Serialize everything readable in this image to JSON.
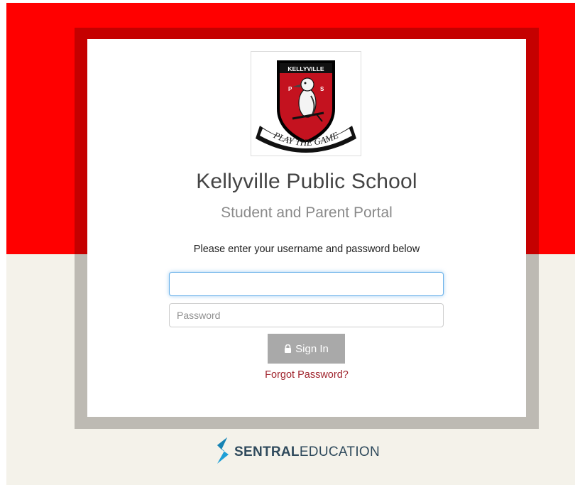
{
  "colors": {
    "brand_red": "#ff0000",
    "frame_dark_red": "#c50000",
    "cream": "#f4f2ea",
    "frame_grey": "#bdbab3",
    "button_grey": "#a9a9a9",
    "link_red": "#a0252e",
    "sentral_blue": "#1e9fd6"
  },
  "logo": {
    "top_text": "KELLYVILLE",
    "left_letter": "P",
    "right_letter": "S",
    "motto": "PLAY THE GAME"
  },
  "school_name": "Kellyville Public School",
  "portal_name": "Student and Parent Portal",
  "instructions": "Please enter your username and password below",
  "username": {
    "value": "",
    "placeholder": ""
  },
  "password": {
    "value": "",
    "placeholder": "Password"
  },
  "sign_in_label": "Sign In",
  "forgot_password": "Forgot Password?",
  "footer_brand": {
    "bold": "SENTRAL",
    "regular": "EDUCATION"
  }
}
